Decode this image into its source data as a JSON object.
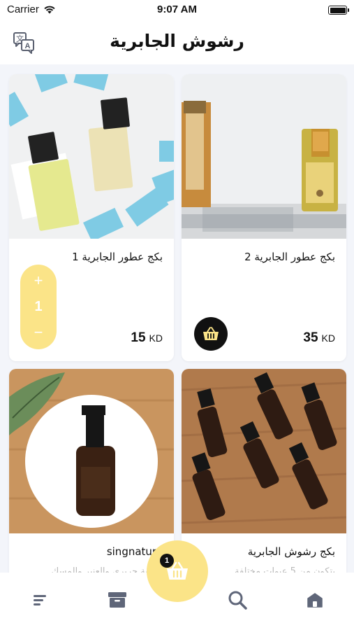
{
  "status_bar": {
    "carrier": "Carrier",
    "time": "9:07 AM"
  },
  "header": {
    "title": "رشوش الجابرية",
    "translate_icon": "translate-icon"
  },
  "products": [
    {
      "name": "بكج عطور الجابرية 2",
      "price": "35",
      "currency": "KD",
      "desc": ""
    },
    {
      "name": "بكج عطور الجابرية 1",
      "price": "15",
      "currency": "KD",
      "desc": ""
    },
    {
      "name": "بكج رشوش الجابرية",
      "price": "",
      "currency": "",
      "desc": "يتكون من 5 عبوات مختلفة"
    },
    {
      "name": "singnature",
      "price": "",
      "currency": "",
      "desc": "بطبقة حريري والعنبر والمسك"
    }
  ],
  "quantity": {
    "plus": "+",
    "count": "1",
    "minus": "−"
  },
  "cart": {
    "count": "1"
  },
  "tabbar": {
    "icons": [
      "menu-icon",
      "archive-icon",
      "search-icon",
      "home-icon"
    ]
  },
  "colors": {
    "accent": "#fbe488",
    "dark": "#111111",
    "tab_icon": "#5f6679"
  }
}
